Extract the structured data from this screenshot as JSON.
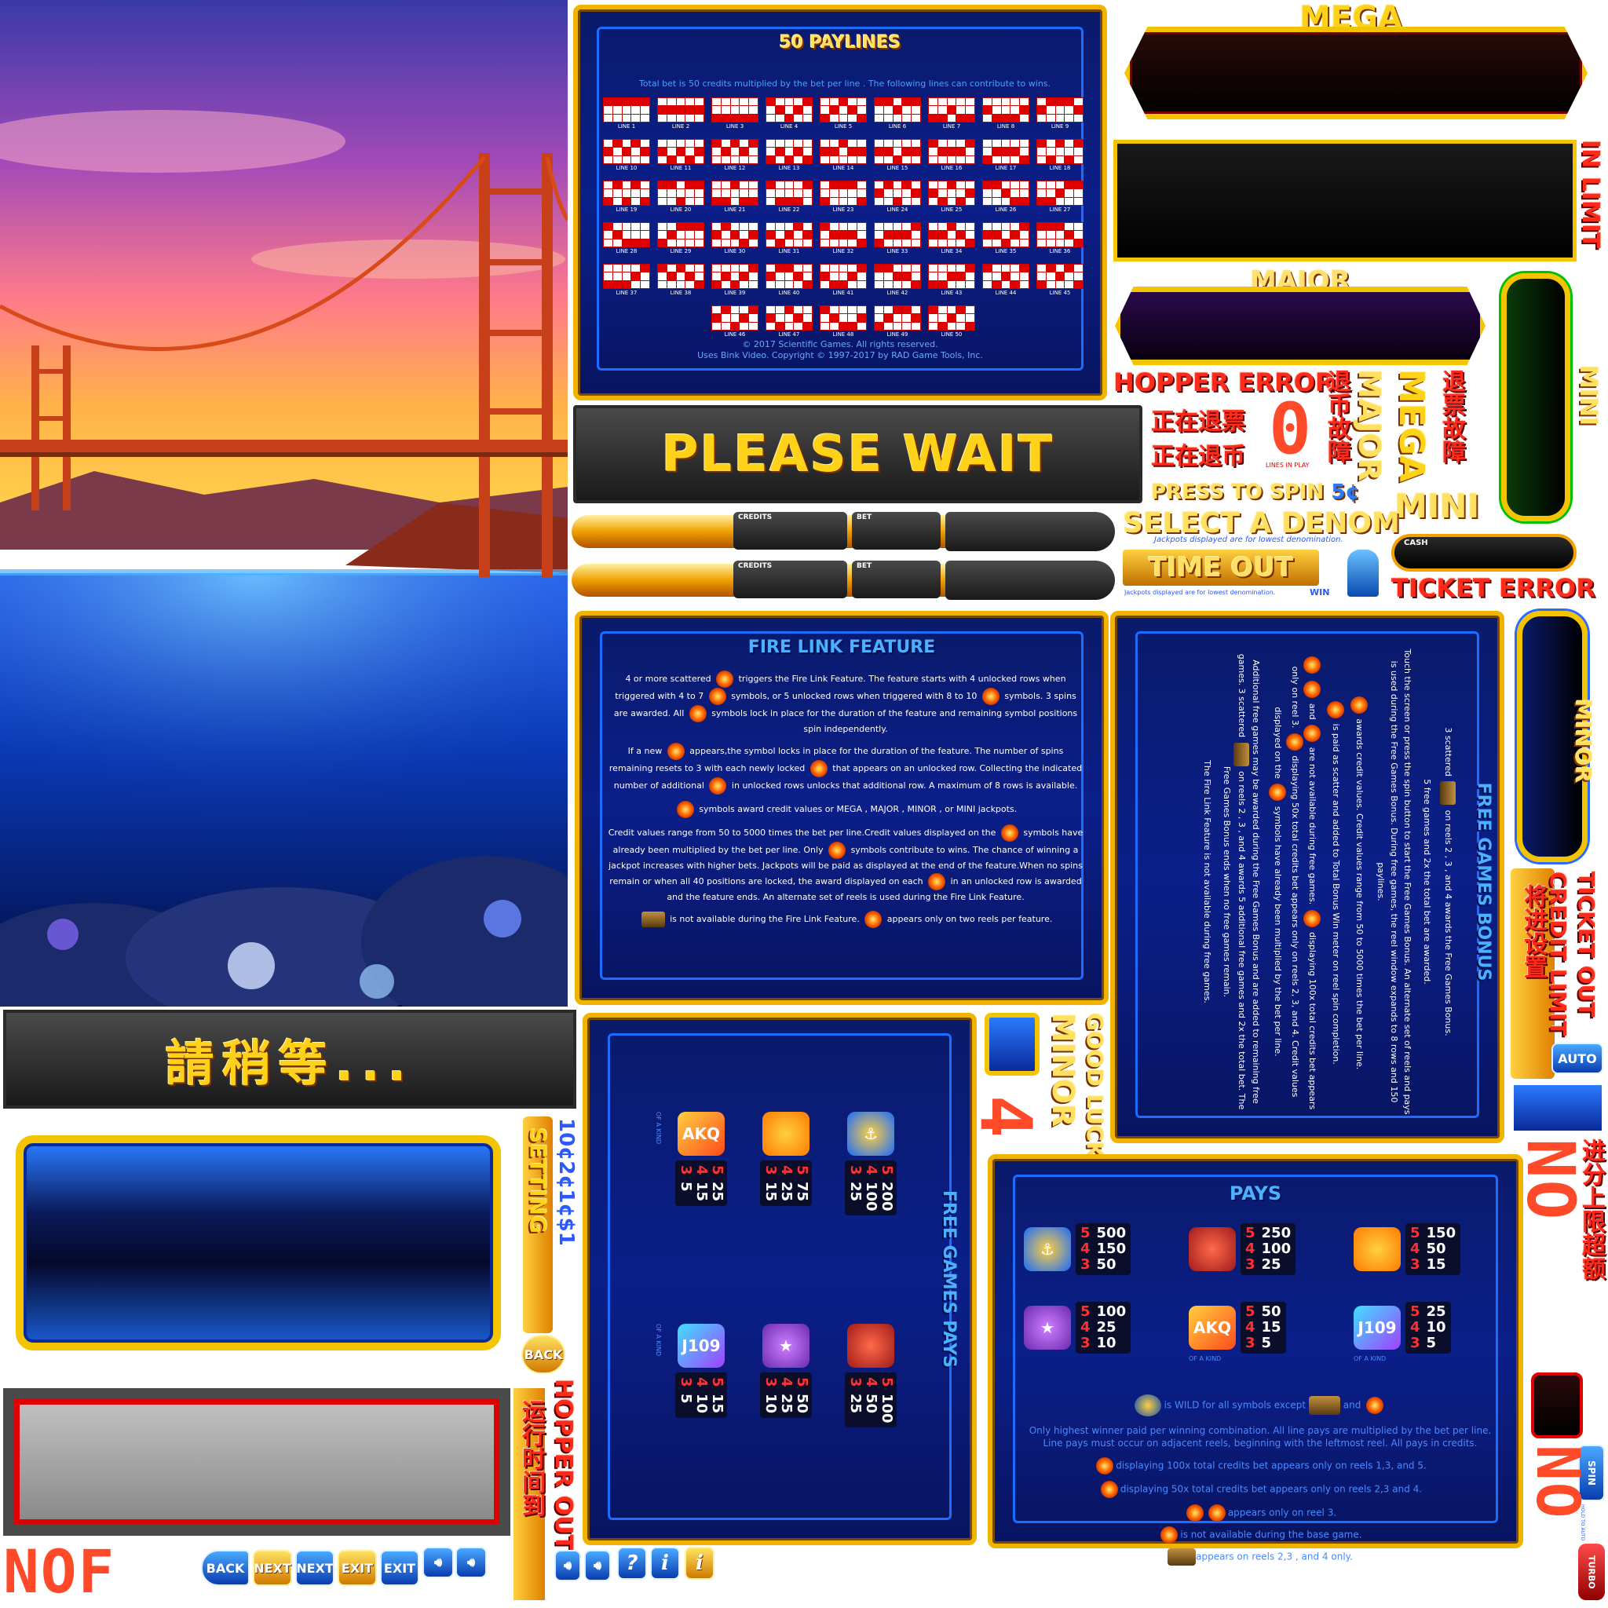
{
  "paylines": {
    "title": "50 PAYLINES",
    "intro": "Total bet is 50 credits multiplied by the bet per line . The following lines can contribute to wins.",
    "lines": [
      {
        "label": "LINE 1",
        "rows": [
          0,
          0,
          0,
          0,
          0
        ]
      },
      {
        "label": "LINE 2",
        "rows": [
          1,
          1,
          1,
          1,
          1
        ]
      },
      {
        "label": "LINE 3",
        "rows": [
          2,
          2,
          2,
          2,
          2
        ]
      },
      {
        "label": "LINE 4",
        "rows": [
          0,
          1,
          2,
          1,
          0
        ]
      },
      {
        "label": "LINE 5",
        "rows": [
          2,
          1,
          0,
          1,
          2
        ]
      },
      {
        "label": "LINE 6",
        "rows": [
          0,
          0,
          1,
          0,
          0
        ]
      },
      {
        "label": "LINE 7",
        "rows": [
          2,
          2,
          1,
          2,
          2
        ]
      },
      {
        "label": "LINE 8",
        "rows": [
          1,
          2,
          2,
          2,
          1
        ]
      },
      {
        "label": "LINE 9",
        "rows": [
          1,
          0,
          0,
          0,
          1
        ]
      },
      {
        "label": "LINE 10",
        "rows": [
          1,
          0,
          1,
          0,
          1
        ]
      },
      {
        "label": "LINE 11",
        "rows": [
          1,
          2,
          1,
          2,
          1
        ]
      },
      {
        "label": "LINE 12",
        "rows": [
          0,
          1,
          0,
          1,
          0
        ]
      },
      {
        "label": "LINE 13",
        "rows": [
          2,
          1,
          2,
          1,
          2
        ]
      },
      {
        "label": "LINE 14",
        "rows": [
          1,
          1,
          0,
          1,
          1
        ]
      },
      {
        "label": "LINE 15",
        "rows": [
          1,
          1,
          2,
          1,
          1
        ]
      },
      {
        "label": "LINE 16",
        "rows": [
          0,
          1,
          1,
          1,
          0
        ]
      },
      {
        "label": "LINE 17",
        "rows": [
          2,
          1,
          1,
          1,
          2
        ]
      },
      {
        "label": "LINE 18",
        "rows": [
          0,
          2,
          0,
          2,
          0
        ]
      },
      {
        "label": "LINE 19",
        "rows": [
          2,
          0,
          2,
          0,
          2
        ]
      },
      {
        "label": "LINE 20",
        "rows": [
          0,
          0,
          2,
          0,
          0
        ]
      },
      {
        "label": "LINE 21",
        "rows": [
          2,
          2,
          0,
          2,
          2
        ]
      },
      {
        "label": "LINE 22",
        "rows": [
          0,
          2,
          2,
          2,
          0
        ]
      },
      {
        "label": "LINE 23",
        "rows": [
          2,
          0,
          0,
          0,
          2
        ]
      },
      {
        "label": "LINE 24",
        "rows": [
          1,
          0,
          2,
          0,
          1
        ]
      },
      {
        "label": "LINE 25",
        "rows": [
          1,
          2,
          0,
          2,
          1
        ]
      },
      {
        "label": "LINE 26",
        "rows": [
          0,
          0,
          1,
          2,
          2
        ]
      },
      {
        "label": "LINE 27",
        "rows": [
          2,
          2,
          1,
          0,
          0
        ]
      },
      {
        "label": "LINE 28",
        "rows": [
          0,
          1,
          2,
          2,
          2
        ]
      },
      {
        "label": "LINE 29",
        "rows": [
          2,
          1,
          0,
          0,
          0
        ]
      },
      {
        "label": "LINE 30",
        "rows": [
          1,
          0,
          1,
          2,
          1
        ]
      },
      {
        "label": "LINE 31",
        "rows": [
          1,
          2,
          1,
          0,
          1
        ]
      },
      {
        "label": "LINE 32",
        "rows": [
          0,
          1,
          1,
          1,
          2
        ]
      },
      {
        "label": "LINE 33",
        "rows": [
          2,
          1,
          1,
          1,
          0
        ]
      },
      {
        "label": "LINE 34",
        "rows": [
          1,
          1,
          0,
          1,
          2
        ]
      },
      {
        "label": "LINE 35",
        "rows": [
          1,
          1,
          2,
          1,
          0
        ]
      },
      {
        "label": "LINE 36",
        "rows": [
          0,
          0,
          0,
          1,
          2
        ]
      },
      {
        "label": "LINE 37",
        "rows": [
          2,
          2,
          2,
          1,
          0
        ]
      },
      {
        "label": "LINE 38",
        "rows": [
          0,
          1,
          0,
          1,
          2
        ]
      },
      {
        "label": "LINE 39",
        "rows": [
          2,
          1,
          2,
          1,
          0
        ]
      },
      {
        "label": "LINE 40",
        "rows": [
          1,
          0,
          0,
          1,
          2
        ]
      },
      {
        "label": "LINE 41",
        "rows": [
          1,
          2,
          2,
          1,
          0
        ]
      },
      {
        "label": "LINE 42",
        "rows": [
          0,
          0,
          1,
          1,
          2
        ]
      },
      {
        "label": "LINE 43",
        "rows": [
          2,
          2,
          1,
          1,
          0
        ]
      },
      {
        "label": "LINE 44",
        "rows": [
          0,
          2,
          1,
          2,
          0
        ]
      },
      {
        "label": "LINE 45",
        "rows": [
          2,
          0,
          1,
          0,
          2
        ]
      },
      {
        "label": "LINE 46",
        "rows": [
          1,
          0,
          2,
          1,
          0
        ]
      },
      {
        "label": "LINE 47",
        "rows": [
          1,
          2,
          0,
          1,
          2
        ]
      },
      {
        "label": "LINE 48",
        "rows": [
          0,
          1,
          2,
          2,
          1
        ]
      },
      {
        "label": "LINE 49",
        "rows": [
          2,
          1,
          0,
          0,
          1
        ]
      },
      {
        "label": "LINE 50",
        "rows": [
          0,
          2,
          1,
          0,
          2
        ]
      }
    ],
    "copyright1": "© 2017 Scientific Games. All rights reserved.",
    "copyright2": "Uses Bink Video. Copyright © 1997-2017 by RAD Game Tools, Inc."
  },
  "please_wait": "PLEASE WAIT",
  "please_wait_cn": "請稍等...",
  "meters": {
    "credits_label": "CREDITS",
    "bet_label": "BET",
    "cash_label": "CASH"
  },
  "jackpots": {
    "mega": "MEGA",
    "major": "MAJOR",
    "minor": "MINOR",
    "mini": "MINI"
  },
  "messages": {
    "hopper_error": "HOPPER ERROR",
    "press_to_spin": "PRESS TO SPIN",
    "press_to_spin_denom": "5¢",
    "select_denom": "SELECT A DENOM",
    "jackpot_note": "Jackpots displayed are for lowest denomination.",
    "time_out": "TIME OUT",
    "ticket_error": "TICKET ERROR",
    "in_limit": "IN LIMIT",
    "ticket_out": "TICKET OUT",
    "credit_limit": "CREDIT LIMIT",
    "good_luck": "GOOD LUCK!",
    "hopper_out": "HOPPER OUT",
    "setting": "SETTING",
    "denoms": "10¢2¢1¢$1",
    "win": "WIN",
    "lines_in_play": "LINES IN PLAY",
    "cn_exit": "正在退票",
    "cn_exit2": "正在退币",
    "cn_handpay": "退币故障",
    "cn_ticket_fault": "退票故障",
    "cn_setting": "将进设置",
    "cn_run_time": "运行时间到",
    "cn_limit": "进分上限超额",
    "digits_left": "NOF",
    "digits_right": "NO"
  },
  "buttons": {
    "back": "BACK",
    "next": "NEXT",
    "exit": "EXIT",
    "auto": "AUTO",
    "spin": "SPIN",
    "hold_to_auto": "HOLD TO AUTO",
    "turbo": "TURBO",
    "help": "?",
    "info": "i"
  },
  "fire_link": {
    "title": "FIRE LINK FEATURE",
    "paragraphs": [
      "4 or more scattered [coin] triggers the Fire Link Feature. The feature starts with 4 unlocked rows when triggered with 4 to 7 [coin] symbols, or 5 unlocked rows when triggered with 8 to 10 [coin] symbols. 3 spins are awarded. All [coin] symbols lock in place for the duration of the feature and remaining symbol positions spin independently.",
      "If a new [coin] appears,the symbol locks in place for the duration of the feature. The number of spins remaining resets to 3 with each newly locked [coin] that appears on an unlocked row. Collecting the indicated number of additional [coin] in unlocked rows unlocks that additional row. A maximum of 8 rows is available.",
      "[coin] symbols award credit values or MEGA , MAJOR , MINOR , or MINI jackpots.",
      "Credit values range from 50 to 5000 times the bet per line.Credit values displayed on the [coin] symbols have already been multiplied by the bet per line. Only [coin] symbols contribute to wins. The chance of winning a jackpot increases with higher bets. Jackpots will be paid as displayed at the end of the feature.When no spins remain or when all 40 positions are locked, the award displayed on each [coin] in an unlocked row is awarded and the feature ends. An alternate set of reels is used during the Fire Link Feature.",
      "[chest] is not available during the Fire Link Feature. [mega] appears only on two reels per feature."
    ]
  },
  "free_games_bonus": {
    "title": "FREE GAMES BONUS",
    "paragraphs": [
      "3 scattered [chest] on reels 2 , 3 , and 4 awards the Free Games Bonus.",
      "5 free games and 2x the total bet are awarded.",
      "Touch the screen or press the spin button to start the Free Games Bonus. An alternate set of reels and pays is used during the Free Games Bonus. During free games, the reel window expands to 8 rows and 150 paylines.",
      "[coin] awards credit values. Credit values range from 50 to 5000 times the bet per line.",
      "[coin] is paid as scatter and added to Total Bonus Win meter on reel spin completion.",
      "[coin] [coin] and [coin] are not available during free games. [coin] displaying 100x total credits bet appears only on reel 3. [coin] displaying 50x total credits bet appears only on reels 2, 3, and 4. Credit values displayed on the [coin] symbols have already been multiplied by the bet per line.",
      "Additional free games may be awarded during the Free Games Bonus and are added to remaining free games. 3 scattered [chest] on reels 2 , 3 , and 4 awards 5 additional free games and 2x the total bet. The Free Games Bonus ends when no free games remain.",
      "The Fire Link Feature is not available during free games."
    ]
  },
  "free_games_pays": {
    "title": "FREE GAMES PAYS",
    "symbols": [
      {
        "icon": "aqk-icon",
        "of_a_kind": "OF A KIND",
        "pays": [
          [
            "5",
            "25"
          ],
          [
            "4",
            "15"
          ],
          [
            "3",
            "5"
          ]
        ]
      },
      {
        "icon": "orange-fish-icon",
        "pays": [
          [
            "5",
            "75"
          ],
          [
            "4",
            "25"
          ],
          [
            "3",
            "15"
          ]
        ]
      },
      {
        "icon": "anchor-icon",
        "pays": [
          [
            "5",
            "200"
          ],
          [
            "4",
            "100"
          ],
          [
            "3",
            "25"
          ]
        ]
      },
      {
        "icon": "j109-icon",
        "of_a_kind": "OF A KIND",
        "pays": [
          [
            "5",
            "15"
          ],
          [
            "4",
            "10"
          ],
          [
            "3",
            "5"
          ]
        ]
      },
      {
        "icon": "starfish-icon",
        "pays": [
          [
            "5",
            "50"
          ],
          [
            "4",
            "25"
          ],
          [
            "3",
            "10"
          ]
        ]
      },
      {
        "icon": "octopus-icon",
        "pays": [
          [
            "5",
            "100"
          ],
          [
            "4",
            "50"
          ],
          [
            "3",
            "25"
          ]
        ]
      }
    ]
  },
  "pays": {
    "title": "PAYS",
    "symbols": [
      {
        "icon": "anchor-icon",
        "pays": [
          [
            "5",
            "500"
          ],
          [
            "4",
            "150"
          ],
          [
            "3",
            "50"
          ]
        ]
      },
      {
        "icon": "octopus-icon",
        "pays": [
          [
            "5",
            "250"
          ],
          [
            "4",
            "100"
          ],
          [
            "3",
            "25"
          ]
        ]
      },
      {
        "icon": "orange-fish-icon",
        "pays": [
          [
            "5",
            "150"
          ],
          [
            "4",
            "50"
          ],
          [
            "3",
            "15"
          ]
        ]
      },
      {
        "icon": "starfish-icon",
        "pays": [
          [
            "5",
            "100"
          ],
          [
            "4",
            "25"
          ],
          [
            "3",
            "10"
          ]
        ]
      },
      {
        "icon": "aqk-icon",
        "of_a_kind": "OF A KIND",
        "pays": [
          [
            "5",
            "50"
          ],
          [
            "4",
            "15"
          ],
          [
            "3",
            "5"
          ]
        ]
      },
      {
        "icon": "j109-icon",
        "of_a_kind": "OF A KIND",
        "pays": [
          [
            "5",
            "25"
          ],
          [
            "4",
            "10"
          ],
          [
            "3",
            "5"
          ]
        ]
      }
    ],
    "notes": [
      "is WILD for all symbols except",
      "and",
      "Only highest winner paid per winning combination. All line pays are multiplied by the bet per line.",
      "Line pays must occur on adjacent reels, beginning with the leftmost reel. All pays in credits.",
      "displaying 100x total credits bet appears only on reels 1,3, and 5.",
      "displaying 50x total credits bet appears only on reels 2,3 and 4.",
      "appears only on reel 3.",
      "is not available during the base game.",
      "appears on reels 2,3 , and 4 only."
    ]
  },
  "colors": {
    "gold": "#f0b400",
    "panel_blue": "#0b1f8a",
    "fire_red": "#e00000",
    "jackpot_red": "#ff2a1a"
  }
}
